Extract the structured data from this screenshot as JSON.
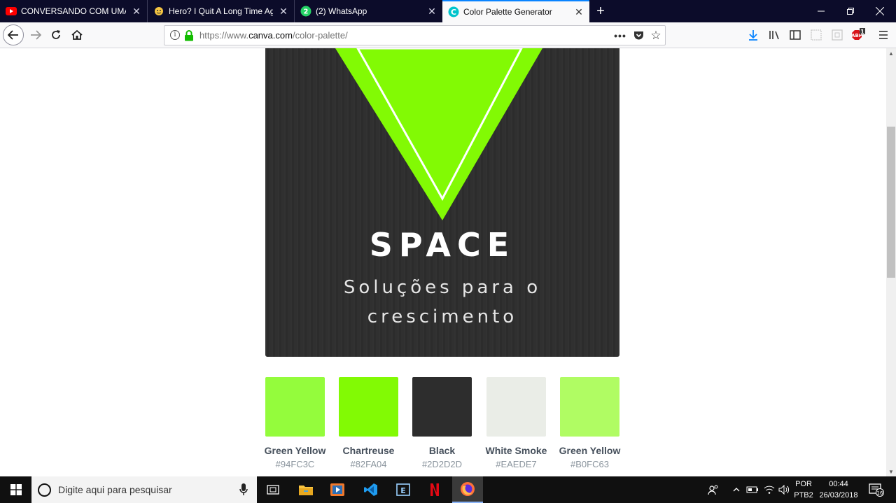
{
  "browser": {
    "tabs": [
      {
        "label": "CONVERSANDO COM UMA AT",
        "icon": "youtube-icon",
        "active": false
      },
      {
        "label": "Hero? I Quit A Long Time Ago",
        "icon": "webtoon-icon",
        "active": false
      },
      {
        "label": "(2) WhatsApp",
        "icon": "whatsapp-icon",
        "active": false,
        "badge": "2"
      },
      {
        "label": "Color Palette Generator",
        "icon": "canva-icon",
        "active": true,
        "badge": "C"
      }
    ],
    "url_prefix": "https://www.",
    "url_domain": "canva.com",
    "url_path": "/color-palette/",
    "toolbar_badge_count": "1",
    "accent_color": "#0a84ff"
  },
  "poster": {
    "title": "SPACE",
    "subtitle_line1": "Soluções para o",
    "subtitle_line2": "crescimento",
    "background": "#2D2D2D",
    "triangle_outer": "#82FA04",
    "triangle_stroke": "#ffffff"
  },
  "palette": [
    {
      "name": "Green Yellow",
      "hex": "#94FC3C"
    },
    {
      "name": "Chartreuse",
      "hex": "#82FA04"
    },
    {
      "name": "Black",
      "hex": "#2D2D2D"
    },
    {
      "name": "White Smoke",
      "hex": "#EAEDE7"
    },
    {
      "name": "Green Yellow",
      "hex": "#B0FC63"
    }
  ],
  "taskbar": {
    "search_placeholder": "Digite aqui para pesquisar",
    "language_top": "POR",
    "language_bottom": "PTB2",
    "time": "00:44",
    "date": "26/03/2018",
    "notification_count": "16"
  }
}
